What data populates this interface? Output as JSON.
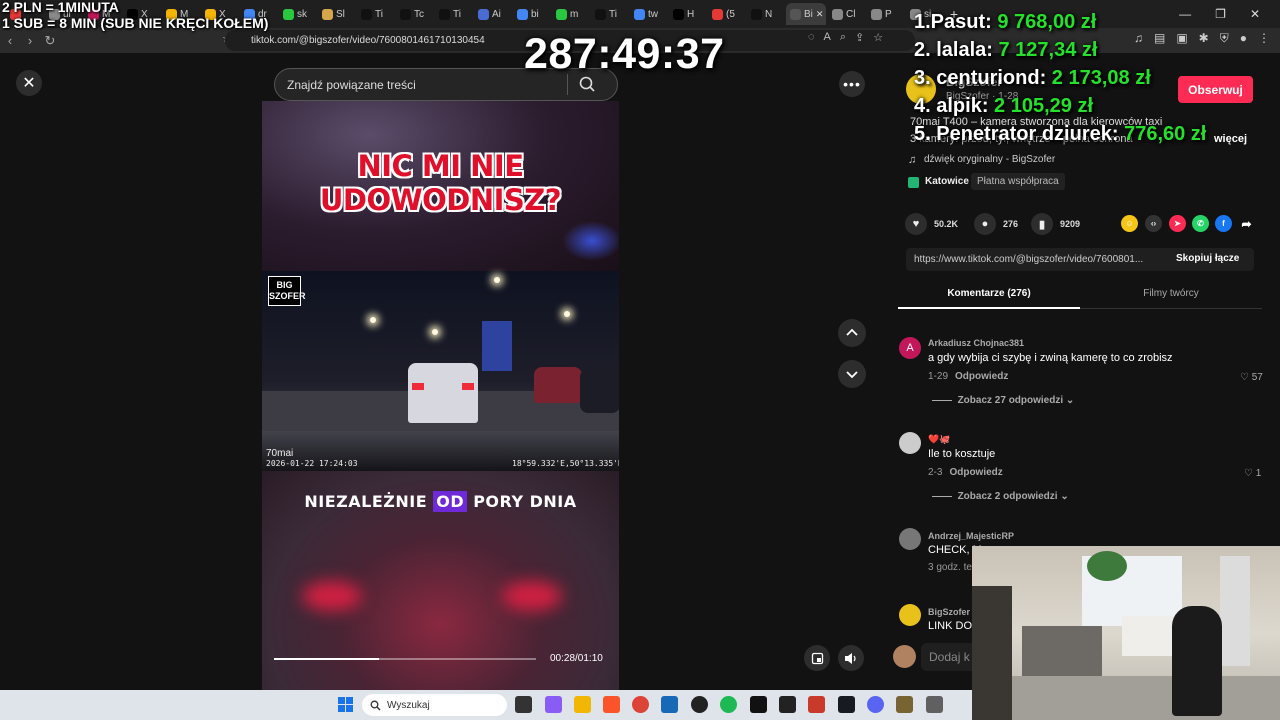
{
  "browser": {
    "tabs": [
      {
        "label": "",
        "color": "#e53935"
      },
      {
        "label": "ul",
        "color": "#888888"
      },
      {
        "label": "M",
        "color": "#c2185b"
      },
      {
        "label": "X",
        "color": "#000000"
      },
      {
        "label": "M",
        "color": "#f4b400"
      },
      {
        "label": "X",
        "color": "#f4b400"
      },
      {
        "label": "dr",
        "color": "#4285f4"
      },
      {
        "label": "sk",
        "color": "#28c840"
      },
      {
        "label": "Sl",
        "color": "#d4a84a"
      },
      {
        "label": "Ti",
        "color": "#111111"
      },
      {
        "label": "Tc",
        "color": "#111111"
      },
      {
        "label": "Ti",
        "color": "#111111"
      },
      {
        "label": "Ai",
        "color": "#4a6cd2"
      },
      {
        "label": "bi",
        "color": "#4285f4"
      },
      {
        "label": "m",
        "color": "#28c840"
      },
      {
        "label": "Ti",
        "color": "#111111"
      },
      {
        "label": "tw",
        "color": "#4285f4"
      },
      {
        "label": "H",
        "color": "#000000"
      },
      {
        "label": "(5",
        "color": "#e53935"
      },
      {
        "label": "N",
        "color": "#111111"
      },
      {
        "label": "Bi",
        "color": "#555555",
        "active": true
      },
      {
        "label": "Cl",
        "color": "#888888"
      },
      {
        "label": "P",
        "color": "#888888"
      },
      {
        "label": "si",
        "color": "#888888"
      }
    ],
    "close_tab": "✕",
    "new_tab": "+",
    "url": "tiktok.com/@bigszofer/video/7600801461710130454"
  },
  "overlays": {
    "line1": "2 PLN = 1MINUTA",
    "line2": "1 SUB = 8 MIN (SUB NIE KRĘCI KOŁEM)",
    "timer": "287:49:37",
    "leaderboard": [
      {
        "name": "1.Pasut:",
        "amount": "9 768,00 zł"
      },
      {
        "name": "2. lalala:",
        "amount": "7 127,34 zł"
      },
      {
        "name": "3. centuriond:",
        "amount": "2 173,08 zł"
      },
      {
        "name": "4. alpik:",
        "amount": "2 105,29 zł"
      },
      {
        "name": "5. Penetrator dziurek:",
        "amount": "776,60 zł"
      }
    ]
  },
  "video": {
    "search_placeholder": "Znajdź powiązane treści",
    "headline_line1": "NIC MI NIE",
    "headline_line2": "UDOWODNISZ?",
    "logo_text": "BIG SZOFER",
    "cam_brand": "70mai",
    "cam_date": "2026-01-22 17:24:03",
    "cam_coords": "18°59.332'E,50°13.335'N",
    "caption_a": "NIEZALEŻNIE",
    "caption_b": "OD",
    "caption_c": "PORY DNIA",
    "progress": 0.4,
    "time": "00:28/01:10"
  },
  "panel": {
    "author": "BigSzofer",
    "author_meta": "BigSzofer · 1-28",
    "follow": "Obserwuj",
    "desc1": "70mai T400 – kamera stworzona dla kierowców taxi",
    "desc2": "3 kamery: przód, tył, wnętrze – pełna ochrona",
    "more": "więcej",
    "sound": "dźwięk oryginalny - BigSzofer",
    "location": "Katowice",
    "paid": "Płatna współpraca",
    "likes": "50.2K",
    "comments": "276",
    "saves": "9209",
    "share_url": "https://www.tiktok.com/@bigszofer/video/7600801...",
    "copy_link": "Skopiuj łącze",
    "tab_comments": "Komentarze (276)",
    "tab_creator": "Filmy twórcy",
    "comment_list": [
      {
        "user": "Arkadiusz Chojnac381",
        "text": "a gdy wybija ci szybę i zwiną kamerę to co zrobisz",
        "date": "1-29",
        "reply": "Odpowiedz",
        "likes": "57",
        "more": "Zobacz 27 odpowiedzi"
      },
      {
        "user": "❤️🐙",
        "text": "Ile to kosztuje",
        "date": "2-3",
        "reply": "Odpowiedz",
        "likes": "1",
        "more": "Zobacz 2 odpowiedzi"
      },
      {
        "user": "Andrzej_MajesticRP",
        "text": "CHECK, M",
        "date": "3 godz. te",
        "reply": "",
        "likes": "",
        "more": ""
      },
      {
        "user": "BigSzofer",
        "text": "LINK DO",
        "date": "",
        "reply": "",
        "likes": "",
        "more": ""
      }
    ],
    "add_comment": "Dodaj k"
  },
  "taskbar": {
    "search": "Wyszukaj"
  }
}
